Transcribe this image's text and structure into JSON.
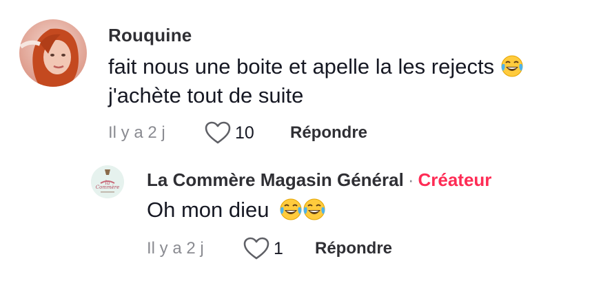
{
  "comment": {
    "username": "Rouquine",
    "text_line1": "fait nous une boite et apelle la les rejects",
    "text_line2": "j'achète tout de suite",
    "emoji_icon": "face-with-tears-of-joy-icon",
    "time": "Il y a 2 j",
    "likes": "10",
    "reply_label": "Répondre"
  },
  "reply": {
    "author": "La Commère Magasin Général",
    "separator": "·",
    "badge": "Créateur",
    "text": "Oh mon dieu",
    "emoji_icons": [
      "face-with-tears-of-joy-icon",
      "face-with-tears-of-joy-icon"
    ],
    "time": "Il y a 2 j",
    "likes": "1",
    "reply_label": "Répondre"
  },
  "colors": {
    "badge": "#fe2c55",
    "meta": "#8a8b91",
    "text": "#161823"
  }
}
